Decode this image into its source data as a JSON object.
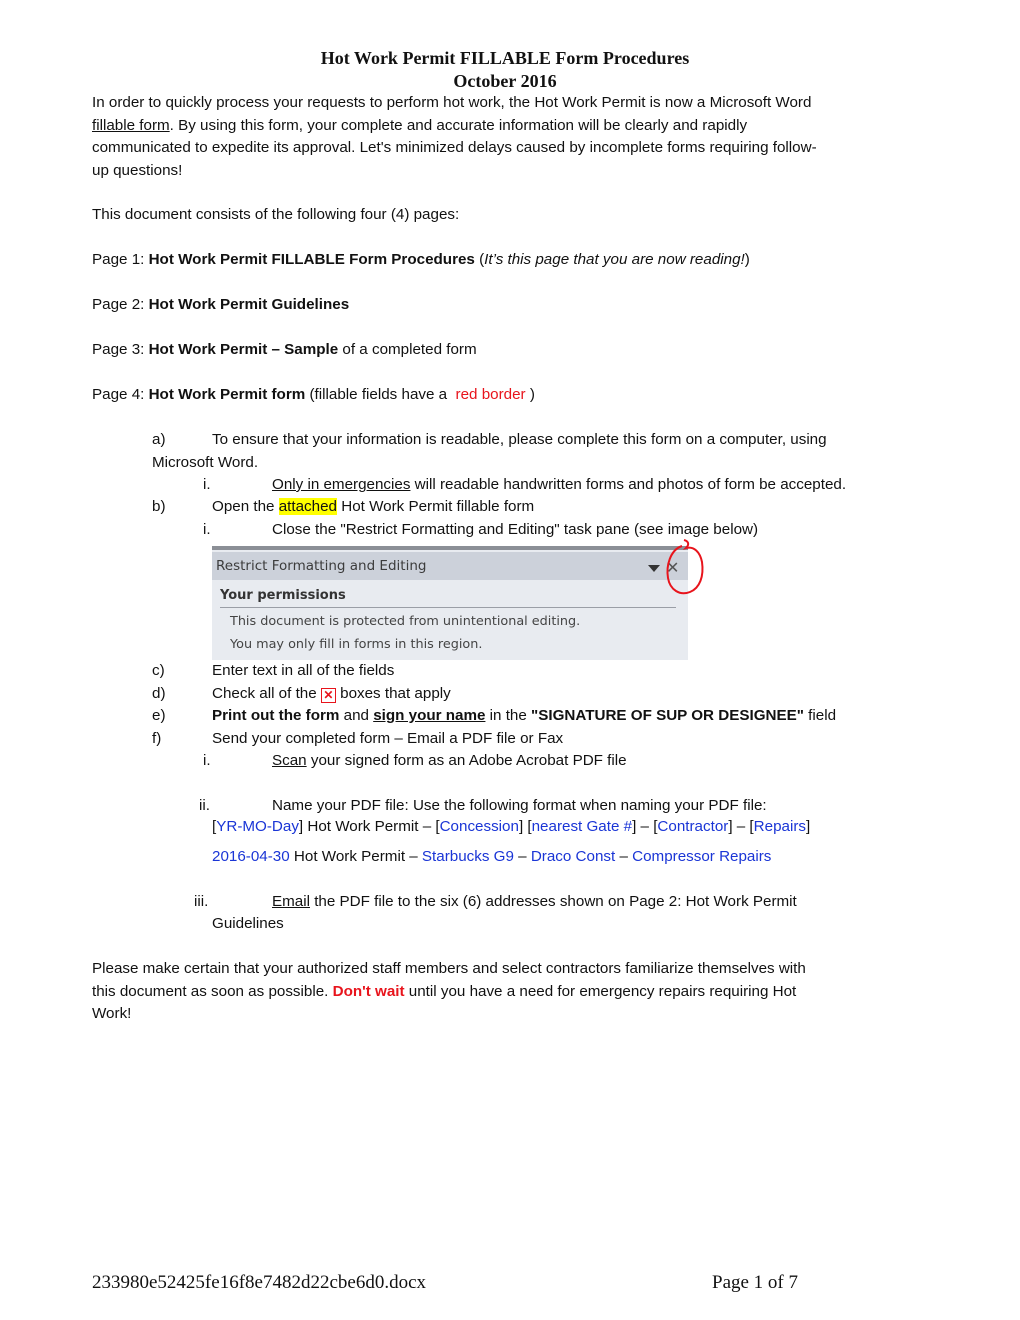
{
  "header": {
    "title": "Hot Work Permit FILLABLE Form Procedures",
    "date": "October 2016"
  },
  "intro": {
    "part1": "In order to quickly process your requests to perform hot work, the Hot Work Permit is now a Microsoft Word",
    "link": "fillable form",
    "part2": ".  By using this form, your complete and accurate information will be clearly and rapidly",
    "line3": "communicated to expedite its approval.  Let's minimized delays caused by incomplete forms requiring follow-",
    "line4": "up questions!"
  },
  "pages_intro": "This document consists of the following four (4) pages:",
  "pages": [
    {
      "prefix": "Page 1:  ",
      "bold": "Hot Work Permit FILLABLE Form Procedures",
      "open": "  (",
      "italic": "It’s this page that you are now reading!",
      "close": ")"
    },
    {
      "prefix": "Page 2:  ",
      "bold": "Hot Work Permit Guidelines"
    },
    {
      "prefix": "Page 3:  ",
      "bold": "Hot Work Permit – Sample",
      "rest": " of a completed form"
    },
    {
      "prefix": "Page 4:  ",
      "bold": "Hot Work Permit form",
      "rest": " (fillable fields have a ",
      "red": "red border",
      "close": " )"
    }
  ],
  "steps": {
    "a": {
      "label": "a)",
      "line1": "To ensure that your information is readable, please complete this form on a computer, using",
      "line2": "Microsoft Word."
    },
    "a_i": {
      "label": "i.",
      "underline": "Only in emergencies",
      "rest": " will readable handwritten forms and photos of form be accepted."
    },
    "b": {
      "label": "b)",
      "pre": "Open the ",
      "highlight": "attached",
      "post": " Hot Work Permit fillable form"
    },
    "b_i": {
      "label": "i.",
      "text": "Close the \"Restrict Formatting and Editing\" task pane (see image below)"
    },
    "c": {
      "label": "c)",
      "text": "Enter text in all of the fields"
    },
    "d": {
      "label": "d)",
      "pre": "Check all of the ",
      "box": "✕",
      "post": " boxes that apply"
    },
    "e": {
      "label": "e)",
      "bold1": "Print out the form",
      "mid1": " and ",
      "bold_u": "sign your name",
      "mid2": " in the ",
      "bold2": "\"SIGNATURE OF SUP OR DESIGNEE\"",
      "post": " field"
    },
    "f": {
      "label": "f)",
      "text": "Send your completed form – Email a PDF file or Fax"
    },
    "f_i": {
      "label": "i.",
      "underline": "Scan",
      "rest": " your signed form as an Adobe Acrobat PDF file"
    },
    "f_ii": {
      "label": "ii.",
      "text": "Name your PDF file:  Use the following format when naming your PDF file:"
    },
    "format": {
      "b1": "[",
      "f1": "YR-MO-Day",
      "b2": "] Hot Work Permit – [",
      "f2": "Concession",
      "b3": "] [",
      "f3": "nearest Gate #",
      "b4": "] – [",
      "f4": "Contractor",
      "b5": "] – [",
      "f5": "Repairs",
      "b6": "]"
    },
    "example": {
      "e1": "2016-04-30",
      "s1": " Hot Work Permit – ",
      "e2": "Starbucks G9",
      "s2": " – ",
      "e3": "Draco Const",
      "s3": " – ",
      "e4": "Compressor Repairs"
    },
    "f_iii": {
      "label": "iii.",
      "underline": "Email",
      "rest": " the PDF file to the six (6) addresses shown on Page 2:  Hot Work Permit",
      "line2": "Guidelines"
    }
  },
  "task_pane": {
    "title": "Restrict Formatting and Editing",
    "section": "Your permissions",
    "line1": "This document is protected from unintentional editing.",
    "line2": "You may only fill in forms in this region.",
    "close_glyph": "✕"
  },
  "closing": {
    "line1": "Please make certain that your authorized staff members and select contractors familiarize themselves with",
    "pre2": "this document as soon as possible.  ",
    "red": "Don't wait",
    "post2": " until you have a need for emergency repairs requiring Hot",
    "line3": "Work!"
  },
  "footer": {
    "filename": "233980e52425fe16f8e7482d22cbe6d0.docx",
    "page": "Page 1 of 7"
  },
  "colors": {
    "red_accent": "#e8141c",
    "blue_field": "#1a35d6",
    "highlight": "#ffff00"
  }
}
